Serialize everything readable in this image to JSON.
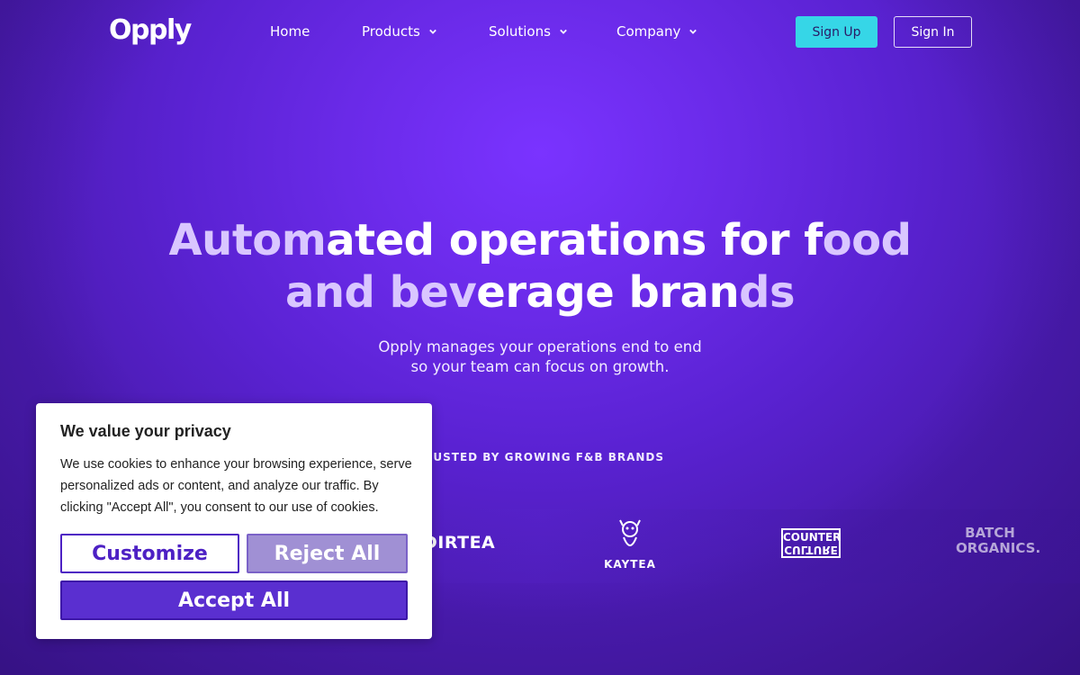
{
  "nav": {
    "logo": "Opply",
    "items": [
      {
        "label": "Home",
        "has_dropdown": false
      },
      {
        "label": "Products",
        "has_dropdown": true
      },
      {
        "label": "Solutions",
        "has_dropdown": true
      },
      {
        "label": "Company",
        "has_dropdown": true
      }
    ],
    "signup_label": "Sign Up",
    "signin_label": "Sign In"
  },
  "hero": {
    "title_line1_a": "Autom",
    "title_line1_b": "ated operations for f",
    "title_line1_c": "ood",
    "title_line2_a": "and bev",
    "title_line2_b": "erage bran",
    "title_line2_c": "ds",
    "subtitle_line1": "Opply manages your operations end to end",
    "subtitle_line2": "so your team can focus on growth.",
    "trusted_label": "TRUSTED BY GROWING F&B BRANDS"
  },
  "brands": {
    "dirtea": "DIRTEA",
    "kaytea": "KAYTEA",
    "counter_line1": "COUNTER",
    "counter_line2": "CULTURE",
    "batch_line1": "BATCH",
    "batch_line2": "ORGANICS."
  },
  "cookie_banner": {
    "title": "We value your privacy",
    "text": "We use cookies to enhance your browsing experience, serve personalized ads or content, and analyze our traffic. By clicking \"Accept All\", you consent to our use of cookies.",
    "customize_label": "Customize",
    "reject_label": "Reject All",
    "accept_label": "Accept All"
  },
  "colors": {
    "background": "#6a2ae8",
    "signup_button": "#36d6e7",
    "accent_purple": "#5a2fd0"
  }
}
